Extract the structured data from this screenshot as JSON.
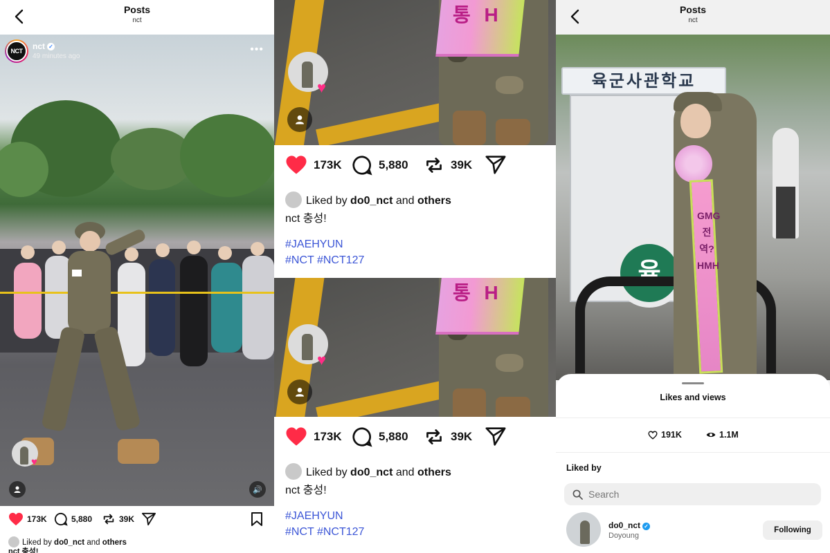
{
  "colors": {
    "heart": "#ff2b47",
    "hashtag": "#3b55d6",
    "verified": "#1d9bf0",
    "gradient_heart": "#ff2d86"
  },
  "panel1": {
    "header": {
      "title": "Posts",
      "subtitle": "nct"
    },
    "post": {
      "username": "nct",
      "avatar_text": "NCT",
      "time_ago": "49 minutes ago",
      "more_icon": "ellipsis-icon"
    },
    "actions": {
      "likes": "173K",
      "comments": "5,880",
      "reposts": "39K"
    },
    "liked_by": {
      "prefix": "Liked by",
      "user": "do0_nct",
      "and": "and",
      "others": "others"
    },
    "caption_partial": "nct 충성!"
  },
  "panel2": {
    "sash_text": "통 H",
    "cards": [
      {
        "actions": {
          "likes": "173K",
          "comments": "5,880",
          "reposts": "39K"
        },
        "liked_by": {
          "prefix": "Liked by",
          "user": "do0_nct",
          "and": "and",
          "others": "others"
        },
        "caption": "nct 충성!",
        "hashtags_line1": "#JAEHYUN",
        "hashtags_line2": "#NCT #NCT127"
      },
      {
        "actions": {
          "likes": "173K",
          "comments": "5,880",
          "reposts": "39K"
        },
        "liked_by": {
          "prefix": "Liked by",
          "user": "do0_nct",
          "and": "and",
          "others": "others"
        },
        "caption": "nct 충성!",
        "hashtags_line1": "#JAEHYUN",
        "hashtags_line2": "#NCT #NCT127"
      }
    ]
  },
  "panel3": {
    "header": {
      "title": "Posts",
      "subtitle": "nct"
    },
    "gate_sign": "육군사관학교",
    "circle_sign": "육",
    "sash_text": "GMG 전역? HMH",
    "sheet": {
      "title": "Likes and views",
      "likes": "191K",
      "views": "1.1M",
      "liked_by_heading": "Liked by",
      "search_placeholder": "Search",
      "user": {
        "name": "do0_nct",
        "display_name": "Doyoung",
        "button": "Following"
      }
    }
  }
}
